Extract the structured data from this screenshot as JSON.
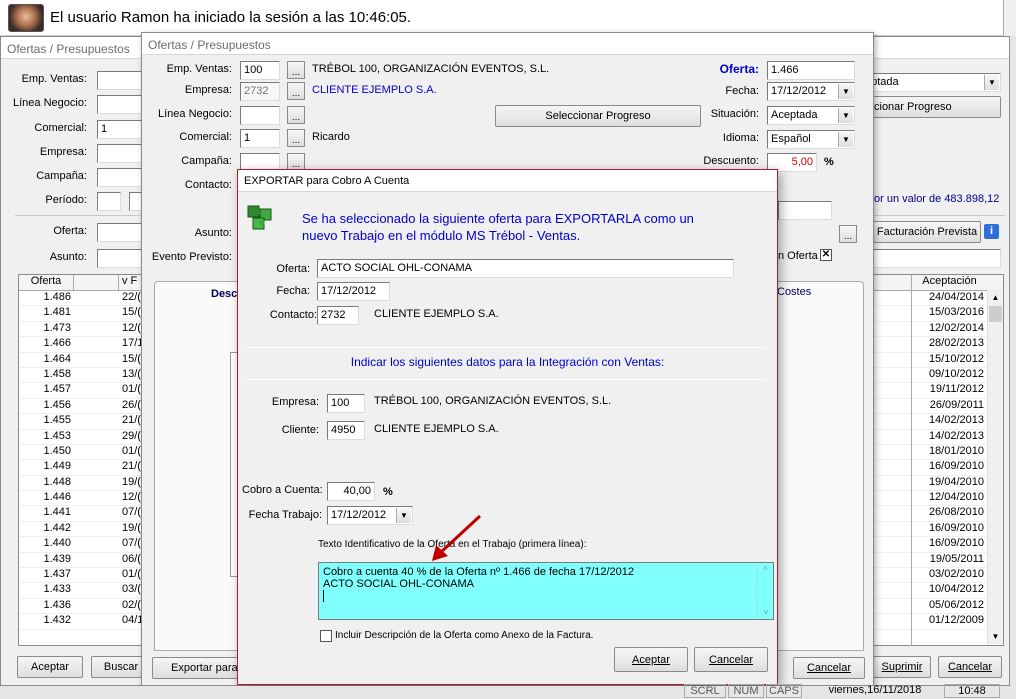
{
  "banner": {
    "text": "El usuario Ramon ha iniciado la sesión a las 10:46:05."
  },
  "back_window": {
    "title": "Ofertas / Presupuestos",
    "labels": {
      "emp_ventas": "Emp. Ventas:",
      "linea": "Línea Negocio:",
      "comercial": "Comercial:",
      "empresa": "Empresa:",
      "campana": "Campaña:",
      "periodo": "Período:",
      "oferta": "Oferta:",
      "asunto": "Asunto:"
    },
    "comercial_value": "1",
    "situacion_value": "eptada",
    "progreso_label": "cionar Progreso",
    "valor_text": "or un valor de 483.898,12",
    "facturacion_label": "Facturación Prevista",
    "col_oferta": "Oferta",
    "col_fecha": "v F",
    "col_aceptacion": "Aceptación",
    "ofertas": [
      "1.486",
      "1.481",
      "1.473",
      "1.466",
      "1.464",
      "1.458",
      "1.457",
      "1.456",
      "1.455",
      "1.453",
      "1.450",
      "1.449",
      "1.448",
      "1.446",
      "1.441",
      "1.442",
      "1.440",
      "1.439",
      "1.437",
      "1.433",
      "1.436",
      "1.432"
    ],
    "fechas_prefix": [
      "22/(",
      "15/(",
      "12/(",
      "17/1",
      "15/(",
      "13/(",
      "01/(",
      "26/(",
      "21/(",
      "29/(",
      "01/(",
      "21/(",
      "19/(",
      "12/(",
      "07/(",
      "19/(",
      "07/(",
      "06/(",
      "01/(",
      "03/(",
      "02/(",
      "04/1"
    ],
    "aceptaciones": [
      "24/04/2014",
      "15/03/2016",
      "12/02/2014",
      "28/02/2013",
      "15/10/2012",
      "09/10/2012",
      "19/11/2012",
      "26/09/2011",
      "14/02/2013",
      "14/02/2013",
      "18/01/2010",
      "16/09/2010",
      "19/04/2010",
      "12/04/2010",
      "26/08/2010",
      "16/09/2010",
      "16/09/2010",
      "19/05/2011",
      "03/02/2010",
      "10/04/2012",
      "05/06/2012",
      "01/12/2009"
    ],
    "btn_aceptar": "Aceptar",
    "btn_buscar": "Buscar",
    "btn_suprimir": "Suprimir",
    "btn_cancelar": "Cancelar"
  },
  "mid_window": {
    "title": "Ofertas / Presupuestos",
    "labels": {
      "emp_ventas": "Emp. Ventas:",
      "empresa": "Empresa:",
      "linea": "Línea Negocio:",
      "comercial": "Comercial:",
      "campana": "Campaña:",
      "contacto": "Contacto:",
      "asunto": "Asunto:",
      "evento": "Evento Previsto:",
      "oferta": "Oferta:",
      "fecha": "Fecha:",
      "situacion": "Situación:",
      "idioma": "Idioma:",
      "descuento": "Descuento:"
    },
    "emp_ventas_value": "100",
    "emp_ventas_name": "TRÉBOL 100, ORGANIZACIÓN EVENTOS, S.L.",
    "empresa_value": "2732",
    "empresa_name": "CLIENTE EJEMPLO S.A.",
    "comercial_value": "1",
    "comercial_name": "Ricardo",
    "oferta_value": "1.466",
    "fecha_value": "17/12/2012",
    "situacion_value": "Aceptada",
    "idioma_value": "Español",
    "descuento_value": "5,00",
    "percent": "%",
    "seleccionar_progreso": "Seleccionar Progreso",
    "tab_desc": "Desc",
    "tab_costes": "Costes",
    "anexo_check": "n Oferta",
    "exportar_btn": "Exportar para C",
    "cancelar_btn": "Cancelar"
  },
  "dialog": {
    "title": "EXPORTAR para Cobro A Cuenta",
    "message": "Se ha seleccionado la siguiente oferta para EXPORTARLA como un nuevo Trabajo en el módulo MS Trébol - Ventas.",
    "oferta_label": "Oferta:",
    "oferta_value": "ACTO SOCIAL OHL-CONAMA",
    "fecha_label": "Fecha:",
    "fecha_value": "17/12/2012",
    "contacto_label": "Contacto:",
    "contacto_value": "2732",
    "contacto_name": "CLIENTE EJEMPLO S.A.",
    "section_heading": "Indicar los siguientes datos para la Integración con Ventas:",
    "empresa_label": "Empresa:",
    "empresa_value": "100",
    "empresa_name": "TRÉBOL 100, ORGANIZACIÓN EVENTOS, S.L.",
    "cliente_label": "Cliente:",
    "cliente_value": "4950",
    "cliente_name": "CLIENTE EJEMPLO S.A.",
    "cobro_label": "Cobro a Cuenta:",
    "cobro_value": "40,00",
    "percent": "%",
    "fecha_trabajo_label": "Fecha Trabajo:",
    "fecha_trabajo_value": "17/12/2012",
    "texto_label": "Texto Identificativo de la Oferta en el Trabajo (primera línea):",
    "texto_line1": "Cobro a cuenta 40 % de la Oferta nº 1.466 de fecha 17/12/2012",
    "texto_line2": "ACTO SOCIAL OHL-CONAMA",
    "checkbox_label": "Incluir Descripción de la Oferta como Anexo de la Factura.",
    "checkbox_checked": false,
    "aceptar": "Aceptar",
    "cancelar": "Cancelar"
  },
  "statusbar": {
    "scrl": "SCRL",
    "num": "NUM",
    "caps": "CAPS",
    "date": "viernes,16/11/2018",
    "time": "10:48"
  },
  "colors": {
    "highlight_bg": "#80ffff",
    "blue_text": "#0000cc",
    "red_text": "#cc0000",
    "dialog_border": "#b01c2c"
  }
}
